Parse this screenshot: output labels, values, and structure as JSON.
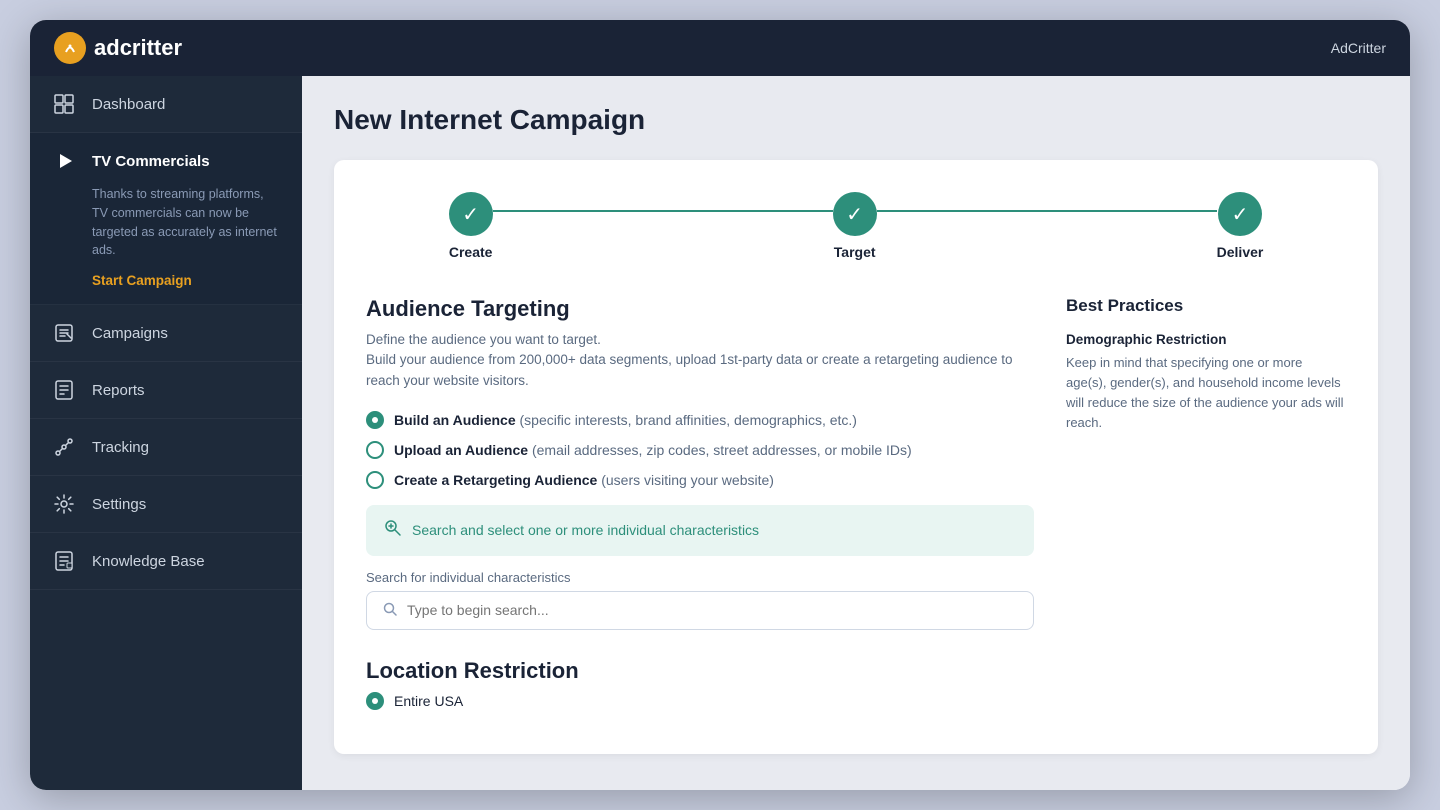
{
  "topbar": {
    "logo_bold": "ad",
    "logo_regular": "critter",
    "brand_name": "AdCritter"
  },
  "sidebar": {
    "items": [
      {
        "id": "dashboard",
        "label": "Dashboard",
        "icon": "⊞"
      },
      {
        "id": "tv-commercials",
        "label": "TV Commercials",
        "icon": "▶",
        "active": true,
        "description": "Thanks to streaming platforms, TV commercials can now be targeted as accurately as internet ads.",
        "cta": "Start Campaign"
      },
      {
        "id": "campaigns",
        "label": "Campaigns",
        "icon": "◇"
      },
      {
        "id": "reports",
        "label": "Reports",
        "icon": "📋"
      },
      {
        "id": "tracking",
        "label": "Tracking",
        "icon": "⚡"
      },
      {
        "id": "settings",
        "label": "Settings",
        "icon": "⚙"
      },
      {
        "id": "knowledge-base",
        "label": "Knowledge Base",
        "icon": "📑"
      }
    ]
  },
  "page": {
    "title": "New Internet Campaign"
  },
  "stepper": {
    "steps": [
      {
        "label": "Create",
        "completed": true
      },
      {
        "label": "Target",
        "completed": true
      },
      {
        "label": "Deliver",
        "completed": true
      }
    ]
  },
  "audience_targeting": {
    "title": "Audience Targeting",
    "description_line1": "Define the audience you want to target.",
    "description_line2": "Build your audience from 200,000+ data segments, upload 1st-party data or create a retargeting audience to reach your website visitors.",
    "options": [
      {
        "id": "build",
        "selected": true,
        "label_main": "Build an Audience",
        "label_sub": " (specific interests, brand affinities, demographics, etc.)"
      },
      {
        "id": "upload",
        "selected": false,
        "label_main": "Upload an Audience",
        "label_sub": " (email addresses, zip codes, street addresses, or mobile IDs)"
      },
      {
        "id": "retargeting",
        "selected": false,
        "label_main": "Create a Retargeting Audience",
        "label_sub": " (users visiting your website)"
      }
    ],
    "search_banner": "Search and select one or more individual characteristics",
    "search_label": "Search for individual characteristics",
    "search_placeholder": "Type to begin search..."
  },
  "location": {
    "title": "Location Restriction",
    "option_entire_usa": "Entire USA"
  },
  "best_practices": {
    "title": "Best Practices",
    "items": [
      {
        "title": "Demographic Restriction",
        "description": "Keep in mind that specifying one or more age(s), gender(s), and household income levels will reduce the size of the audience your ads will reach."
      }
    ]
  }
}
